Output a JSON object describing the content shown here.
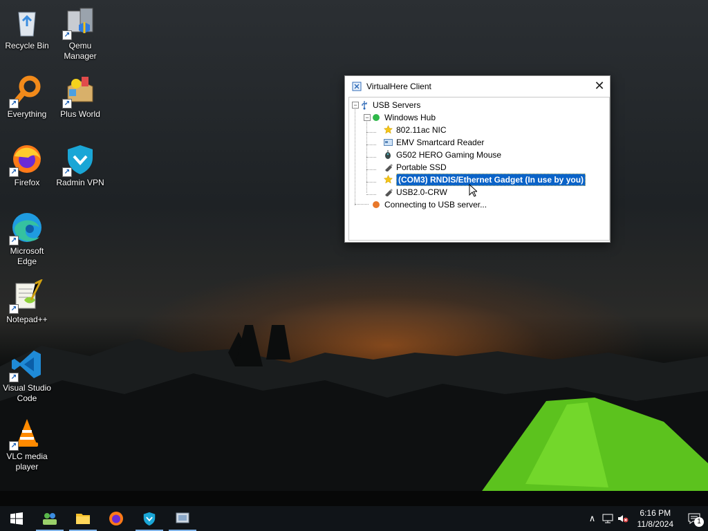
{
  "desktop": {
    "icons": [
      {
        "label": "Recycle Bin",
        "icon": "recycle-bin-icon"
      },
      {
        "label": "Qemu Manager",
        "icon": "qemu-manager-icon"
      },
      {
        "label": "Everything",
        "icon": "everything-search-icon"
      },
      {
        "label": "Plus World",
        "icon": "plus-world-icon"
      },
      {
        "label": "Firefox",
        "icon": "firefox-icon"
      },
      {
        "label": "Radmin VPN",
        "icon": "radmin-vpn-icon"
      },
      {
        "label": "Microsoft Edge",
        "icon": "edge-icon"
      },
      {
        "label": "Notepad++",
        "icon": "notepadpp-icon"
      },
      {
        "label": "Visual Studio Code",
        "icon": "vscode-icon"
      },
      {
        "label": "VLC media player",
        "icon": "vlc-icon"
      }
    ]
  },
  "window": {
    "title": "VirtualHere Client",
    "close_glyph": "✕",
    "tree": {
      "root": "USB Servers",
      "hub": "Windows Hub",
      "devices": [
        {
          "label": "802.11ac NIC",
          "icon": "star-icon"
        },
        {
          "label": "EMV Smartcard Reader",
          "icon": "card-reader-icon"
        },
        {
          "label": "G502 HERO Gaming Mouse",
          "icon": "mouse-icon"
        },
        {
          "label": "Portable SSD",
          "icon": "usb-drive-icon"
        },
        {
          "label": "(COM3) RNDIS/Ethernet Gadget (In use by you)",
          "icon": "star-icon",
          "selected": true
        },
        {
          "label": "USB2.0-CRW",
          "icon": "usb-drive-icon"
        }
      ],
      "status": "Connecting to USB server..."
    }
  },
  "taskbar": {
    "apps": [
      "start-icon",
      "network-people-icon",
      "file-explorer-icon",
      "firefox-icon",
      "radmin-vpn-icon",
      "virtualhere-icon"
    ],
    "clock": {
      "time": "6:16 PM",
      "date": "11/8/2024"
    },
    "notification_count": "1"
  },
  "colors": {
    "selection": "#0a63c8",
    "taskbar": "#101418",
    "hub_status": "#2fb84a",
    "connecting_status": "#e8782a"
  }
}
